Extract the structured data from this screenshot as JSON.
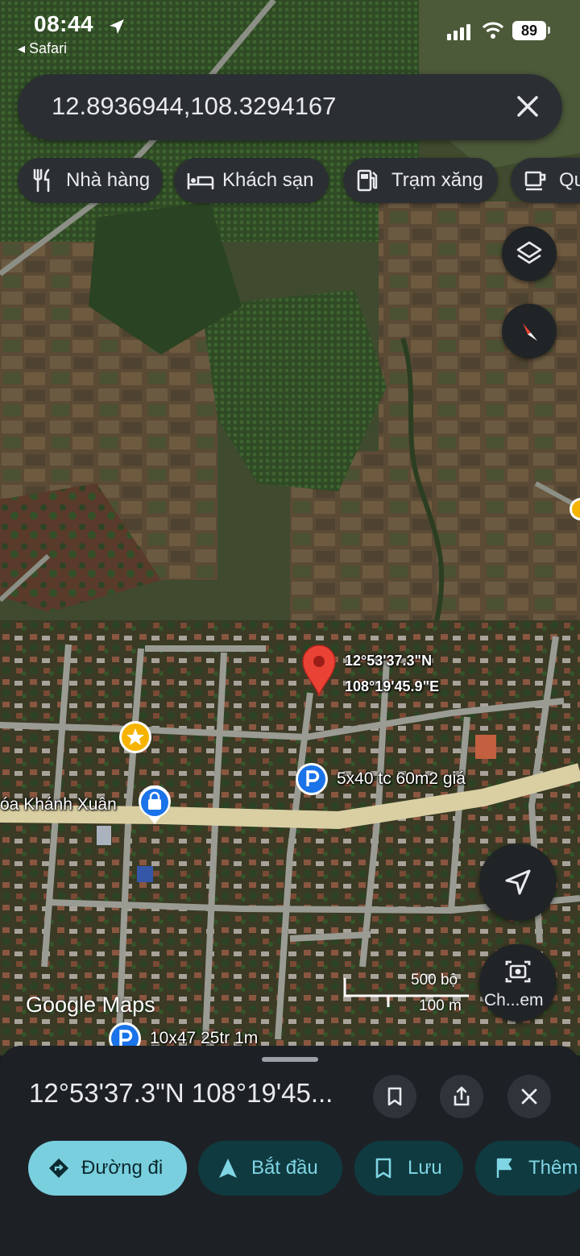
{
  "status_bar": {
    "time": "08:44",
    "back_app": "◂ Safari",
    "battery": "89"
  },
  "search": {
    "query": "12.8936944,108.3294167"
  },
  "categories": [
    {
      "label": "Nhà hàng",
      "icon": "restaurant-icon"
    },
    {
      "label": "Khách sạn",
      "icon": "hotel-icon"
    },
    {
      "label": "Trạm xăng",
      "icon": "gas-station-icon"
    },
    {
      "label": "Qu",
      "icon": "coffee-icon"
    }
  ],
  "map": {
    "pin_lat": "12°53'37.3\"N",
    "pin_lng": "108°19'45.9\"E",
    "place_parking_1": "5x40 tc 60m2 giá",
    "place_shop": "óa Khánh Xuân",
    "place_parking_2": "10x47 25tr 1m",
    "logo": "Google Maps",
    "scale_ft": "500 bộ",
    "scale_m": "100 m",
    "camera_label": "Ch...em"
  },
  "sheet": {
    "title": "12°53'37.3\"N 108°19'45...",
    "actions": [
      {
        "label": "Đường đi",
        "icon": "directions-icon"
      },
      {
        "label": "Bắt đầu",
        "icon": "navigation-icon"
      },
      {
        "label": "Lưu",
        "icon": "bookmark-icon"
      },
      {
        "label": "Thêm",
        "icon": "flag-icon"
      }
    ]
  },
  "colors": {
    "accent": "#79cfde",
    "pin": "#ea4335",
    "surface": "#2b2f33",
    "sheet": "#1d2126"
  }
}
